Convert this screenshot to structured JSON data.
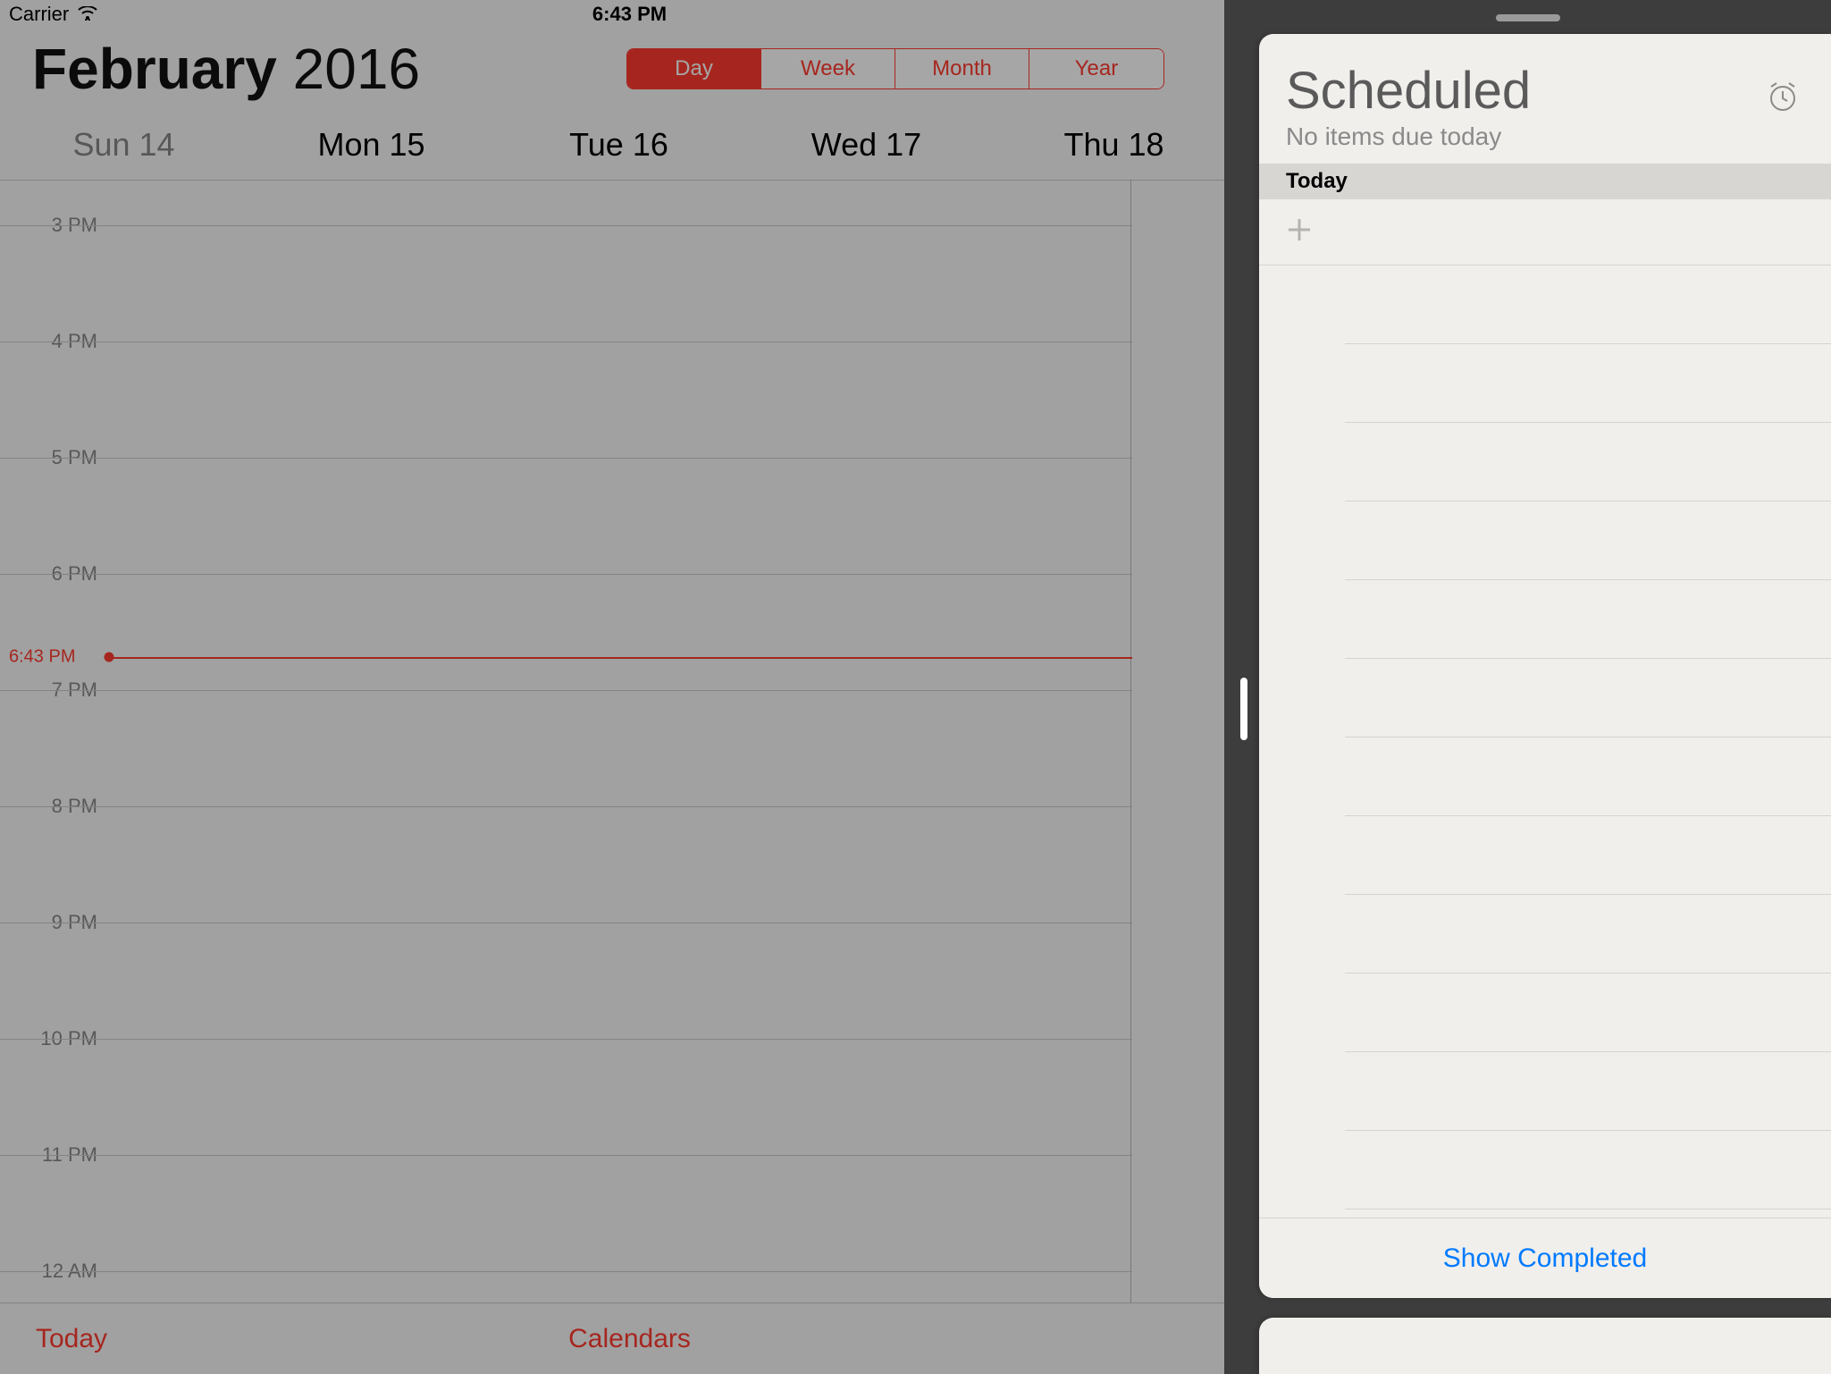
{
  "status_bar": {
    "carrier": "Carrier",
    "time": "6:43 PM"
  },
  "calendar": {
    "month": "February",
    "year": "2016",
    "segments": {
      "day": "Day",
      "week": "Week",
      "month": "Month",
      "year": "Year",
      "active": "Day"
    },
    "weekdays": [
      {
        "label": "Sun 14",
        "dimmed": true
      },
      {
        "label": "Mon 15",
        "dimmed": false
      },
      {
        "label": "Tue 16",
        "dimmed": false
      },
      {
        "label": "Wed 17",
        "dimmed": false
      },
      {
        "label": "Thu 18",
        "dimmed": false
      }
    ],
    "hours": [
      "3 PM",
      "4 PM",
      "5 PM",
      "6 PM",
      "7 PM",
      "8 PM",
      "9 PM",
      "10 PM",
      "11 PM",
      "12 AM"
    ],
    "now_label": "6:43 PM",
    "toolbar": {
      "today": "Today",
      "calendars": "Calendars"
    }
  },
  "reminders": {
    "title": "Scheduled",
    "subtitle": "No items due today",
    "section": "Today",
    "show_completed": "Show Completed"
  }
}
